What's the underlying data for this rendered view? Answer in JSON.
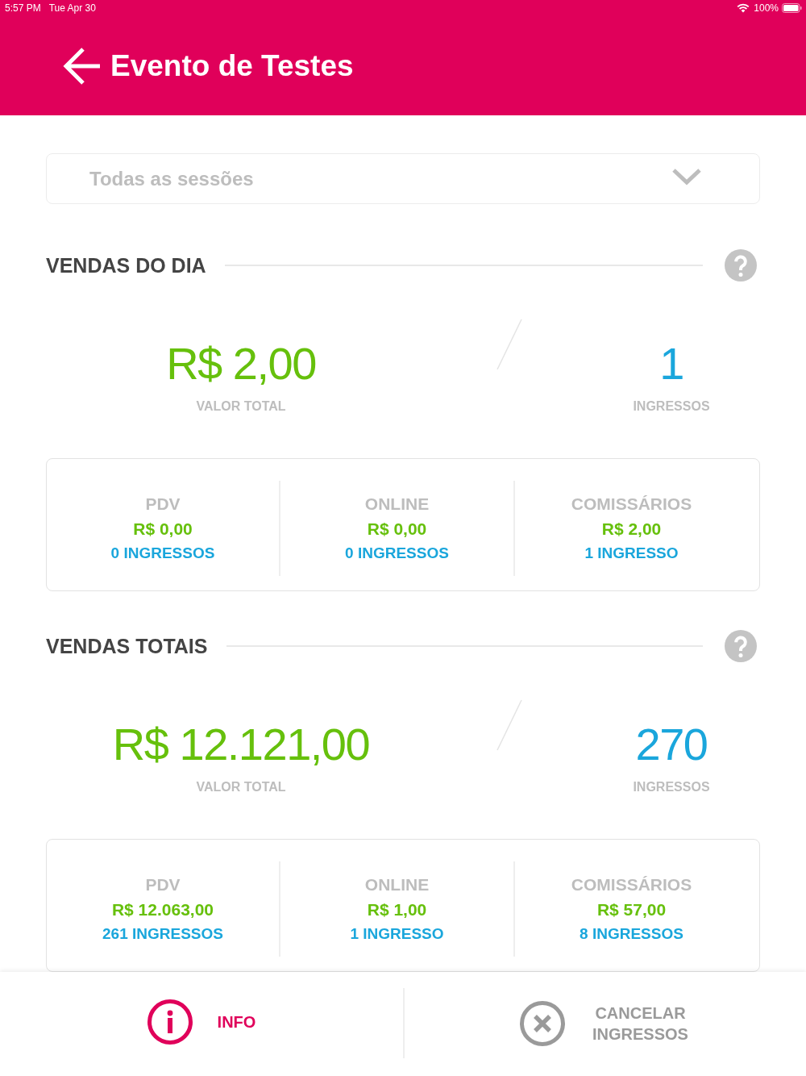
{
  "status_bar": {
    "time": "5:57 PM",
    "date": "Tue Apr 30",
    "battery": "100%"
  },
  "header": {
    "title": "Evento de Testes"
  },
  "session_select": {
    "value": "Todas as sessões"
  },
  "sections": [
    {
      "title": "VENDAS DO DIA",
      "total_value": "R$ 2,00",
      "total_value_label": "VALOR TOTAL",
      "tickets": "1",
      "tickets_label": "INGRESSOS",
      "channels": [
        {
          "name": "PDV",
          "value": "R$ 0,00",
          "tickets": "0 INGRESSOS"
        },
        {
          "name": "ONLINE",
          "value": "R$ 0,00",
          "tickets": "0 INGRESSOS"
        },
        {
          "name": "COMISSÁRIOS",
          "value": "R$ 2,00",
          "tickets": "1 INGRESSO"
        }
      ]
    },
    {
      "title": "VENDAS TOTAIS",
      "total_value": "R$ 12.121,00",
      "total_value_label": "VALOR TOTAL",
      "tickets": "270",
      "tickets_label": "INGRESSOS",
      "channels": [
        {
          "name": "PDV",
          "value": "R$ 12.063,00",
          "tickets": "261 INGRESSOS"
        },
        {
          "name": "ONLINE",
          "value": "R$ 1,00",
          "tickets": "1 INGRESSO"
        },
        {
          "name": "COMISSÁRIOS",
          "value": "R$ 57,00",
          "tickets": "8 INGRESSOS"
        }
      ]
    }
  ],
  "bottom_bar": {
    "buttons": [
      {
        "kind": "info",
        "label": "INFO"
      },
      {
        "kind": "cancel",
        "label": "CANCELAR INGRESSOS"
      }
    ]
  }
}
